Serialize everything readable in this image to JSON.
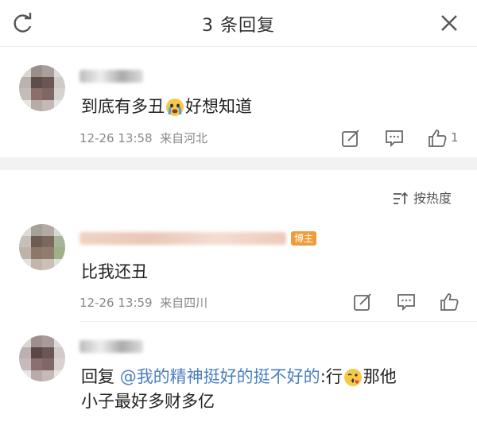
{
  "header": {
    "title": "3 条回复",
    "refresh_icon": "refresh-icon",
    "close_icon": "close-icon"
  },
  "sort": {
    "label": "按热度",
    "icon": "sort-icon"
  },
  "comments": [
    {
      "text_before": "到底有多丑",
      "emoji": "crying-face",
      "text_after": "好想知道",
      "date": "12-26 13:58",
      "location": "来自河北",
      "likes": "1"
    },
    {
      "badge": "博主",
      "text": "比我还丑",
      "date": "12-26 13:59",
      "location": "来自四川"
    },
    {
      "reply_prefix": "回复",
      "mention": "@我的精神挺好的挺不好的",
      "colon_text": ":行",
      "emoji": "kiss-face",
      "text_line1_end": "那他",
      "text_line2": "小子最好多财多亿"
    }
  ],
  "colors": {
    "accent_link": "#4a7fc1",
    "badge": "#f19c3a",
    "separator": "#f2f2f2"
  }
}
